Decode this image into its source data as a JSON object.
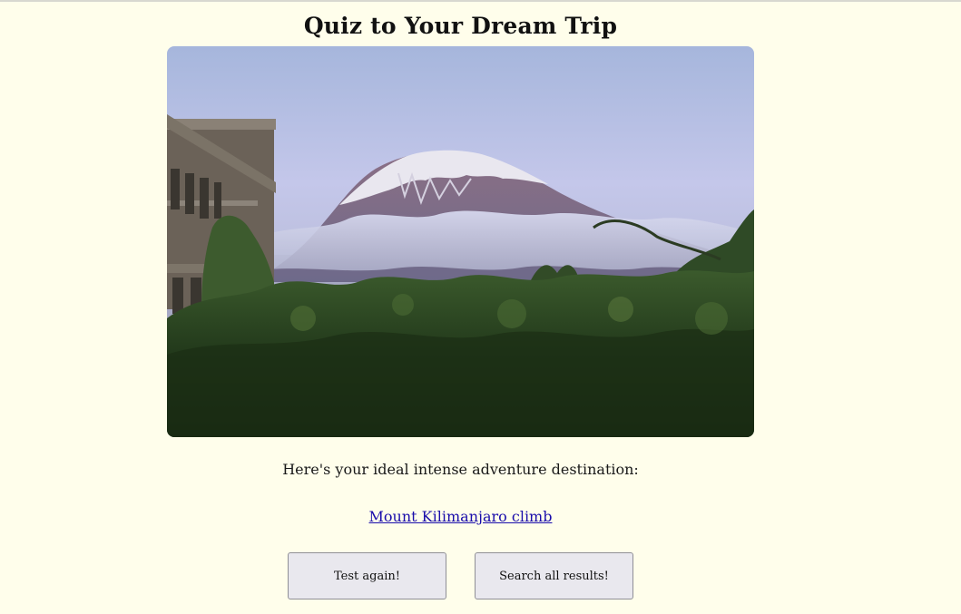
{
  "header": {
    "title": "Quiz to Your Dream Trip"
  },
  "hero_image": {
    "subject": "Mount Kilimanjaro with snow cap above clouds, lush green foliage and a building in foreground"
  },
  "result": {
    "intro": "Here's your ideal intense adventure destination:",
    "destination_link": "Mount Kilimanjaro climb"
  },
  "actions": {
    "test_again_label": "Test again!",
    "search_all_label": "Search all results!"
  },
  "colors": {
    "background": "#fffeeb",
    "link": "#1a0dab",
    "button_bg": "#e9e8ee"
  }
}
